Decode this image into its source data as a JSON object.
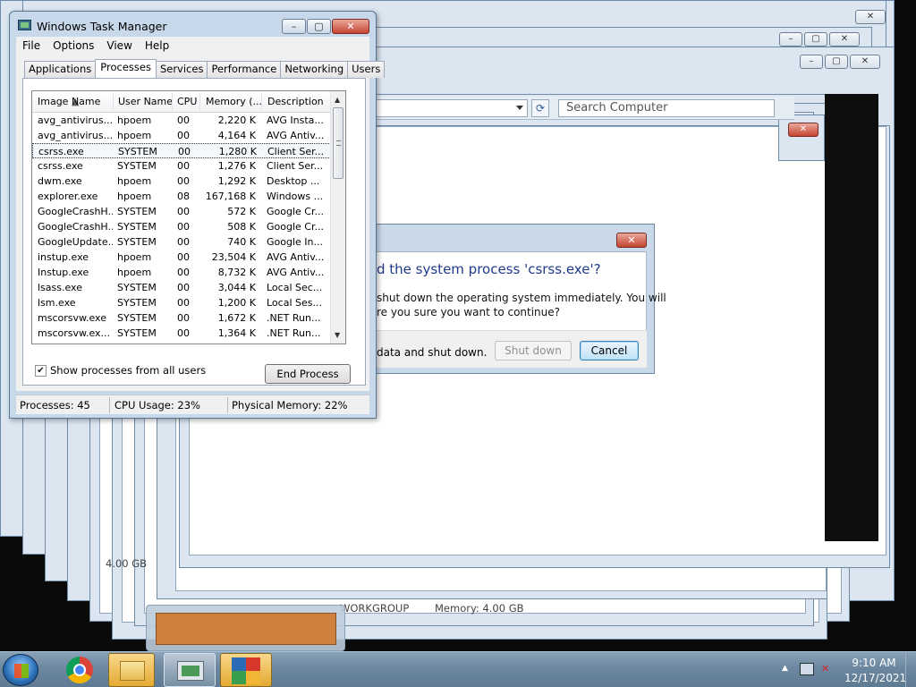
{
  "task_manager": {
    "title": "Windows Task Manager",
    "menu": [
      "File",
      "Options",
      "View",
      "Help"
    ],
    "tabs": [
      "Applications",
      "Processes",
      "Services",
      "Performance",
      "Networking",
      "Users"
    ],
    "active_tab": "Processes",
    "columns": [
      "Image Name",
      "User Name",
      "CPU",
      "Memory (...",
      "Description"
    ],
    "rows": [
      {
        "image": "avg_antivirus...",
        "user": "hpoem",
        "cpu": "00",
        "mem": "2,220 K",
        "desc": "AVG Insta..."
      },
      {
        "image": "avg_antivirus...",
        "user": "hpoem",
        "cpu": "00",
        "mem": "4,164 K",
        "desc": "AVG Antiv..."
      },
      {
        "image": "csrss.exe",
        "user": "SYSTEM",
        "cpu": "00",
        "mem": "1,280 K",
        "desc": "Client Ser..."
      },
      {
        "image": "csrss.exe",
        "user": "SYSTEM",
        "cpu": "00",
        "mem": "1,276 K",
        "desc": "Client Ser..."
      },
      {
        "image": "dwm.exe",
        "user": "hpoem",
        "cpu": "00",
        "mem": "1,292 K",
        "desc": "Desktop ..."
      },
      {
        "image": "explorer.exe",
        "user": "hpoem",
        "cpu": "08",
        "mem": "167,168 K",
        "desc": "Windows ..."
      },
      {
        "image": "GoogleCrashH...",
        "user": "SYSTEM",
        "cpu": "00",
        "mem": "572 K",
        "desc": "Google Cr..."
      },
      {
        "image": "GoogleCrashH...",
        "user": "SYSTEM",
        "cpu": "00",
        "mem": "508 K",
        "desc": "Google Cr..."
      },
      {
        "image": "GoogleUpdate...",
        "user": "SYSTEM",
        "cpu": "00",
        "mem": "740 K",
        "desc": "Google In..."
      },
      {
        "image": "instup.exe",
        "user": "hpoem",
        "cpu": "00",
        "mem": "23,504 K",
        "desc": "AVG Antiv..."
      },
      {
        "image": "Instup.exe",
        "user": "hpoem",
        "cpu": "00",
        "mem": "8,732 K",
        "desc": "AVG Antiv..."
      },
      {
        "image": "lsass.exe",
        "user": "SYSTEM",
        "cpu": "00",
        "mem": "3,044 K",
        "desc": "Local Sec..."
      },
      {
        "image": "lsm.exe",
        "user": "SYSTEM",
        "cpu": "00",
        "mem": "1,200 K",
        "desc": "Local Ses..."
      },
      {
        "image": "mscorsvw.exe",
        "user": "SYSTEM",
        "cpu": "00",
        "mem": "1,672 K",
        "desc": ".NET Run..."
      },
      {
        "image": "mscorsvw.ex...",
        "user": "SYSTEM",
        "cpu": "00",
        "mem": "1,364 K",
        "desc": ".NET Run..."
      }
    ],
    "selected_row": 2,
    "show_all_label": "Show processes from all users",
    "show_all_checked": true,
    "end_process_label": "End Process",
    "status": {
      "processes": "Processes: 45",
      "cpu": "CPU Usage: 23%",
      "memory": "Physical Memory: 22%"
    }
  },
  "dialog": {
    "question": "d the system process 'csrss.exe'?",
    "body_line1": "shut down the operating system immediately.  You will",
    "body_line2": "re you sure you want to continue?",
    "footer_text": "data and shut down.",
    "shutdown_label": "Shut down",
    "cancel_label": "Cancel",
    "close_glyph": "✕"
  },
  "explorer": {
    "search_placeholder": "Search Computer",
    "memory_left": "4.00 GB",
    "workgroup": "WORKGROUP",
    "memory_label": "Memory: 4.00 GB"
  },
  "taskbar": {
    "time": "9:10 AM",
    "date": "12/17/2021",
    "icons": [
      "windows-start-icon",
      "chrome-icon",
      "folder-icon",
      "task-manager-icon",
      "avg-icon"
    ]
  },
  "colors": {
    "window_frame": "#c7d8ea",
    "close_button": "#c5442f",
    "dialog_question": "#1e3a8a",
    "taskbar": "#6c87a0"
  }
}
